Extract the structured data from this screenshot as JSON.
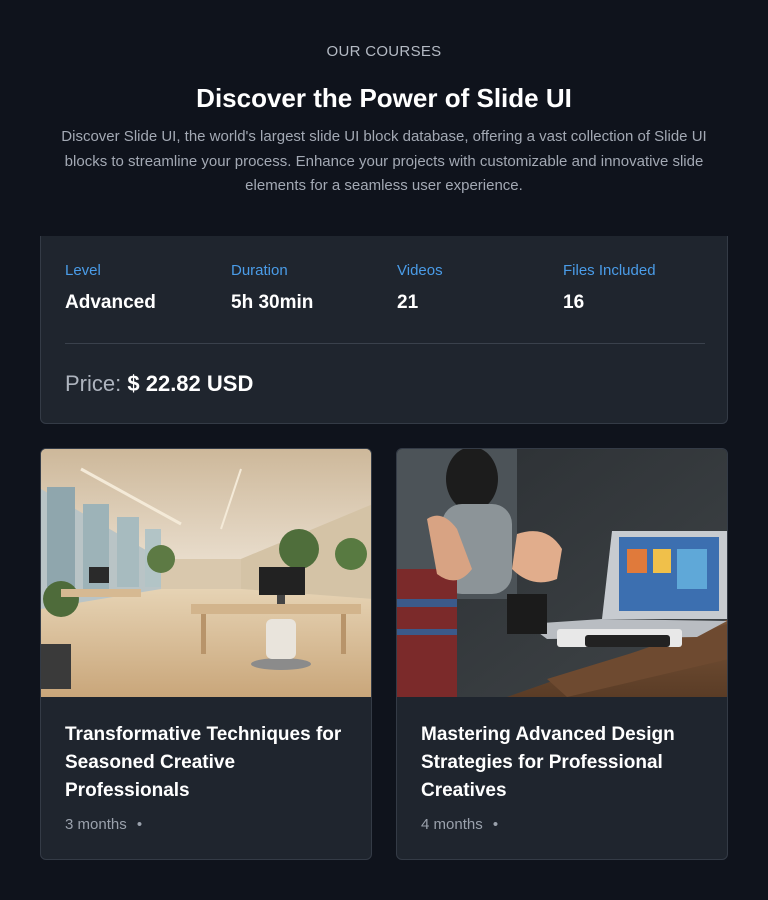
{
  "header": {
    "eyebrow": "OUR COURSES",
    "title": "Discover the Power of Slide UI",
    "description": "Discover Slide UI, the world's largest slide UI block database, offering a vast collection of Slide UI blocks to streamline your process. Enhance your projects with customizable and innovative slide elements for a seamless user experience."
  },
  "stats": [
    {
      "label": "Level",
      "value": "Advanced"
    },
    {
      "label": "Duration",
      "value": "5h 30min"
    },
    {
      "label": "Videos",
      "value": "21"
    },
    {
      "label": "Files Included",
      "value": "16"
    }
  ],
  "price": {
    "label": "Price:",
    "value": "$ 22.82 USD"
  },
  "courses": [
    {
      "title": "Transformative Techniques for Seasoned Creative Professionals",
      "meta": "3 months",
      "meta_separator": "•",
      "image": "office-interior-photo"
    },
    {
      "title": "Mastering Advanced Design Strategies for Professional Creatives",
      "meta": "4 months",
      "meta_separator": "•",
      "image": "hands-laptop-meeting-photo"
    }
  ],
  "colors": {
    "background": "#0f131c",
    "panel": "#1f252e",
    "accent_label": "#4a9ce8",
    "text_muted": "#a3a9b4"
  }
}
